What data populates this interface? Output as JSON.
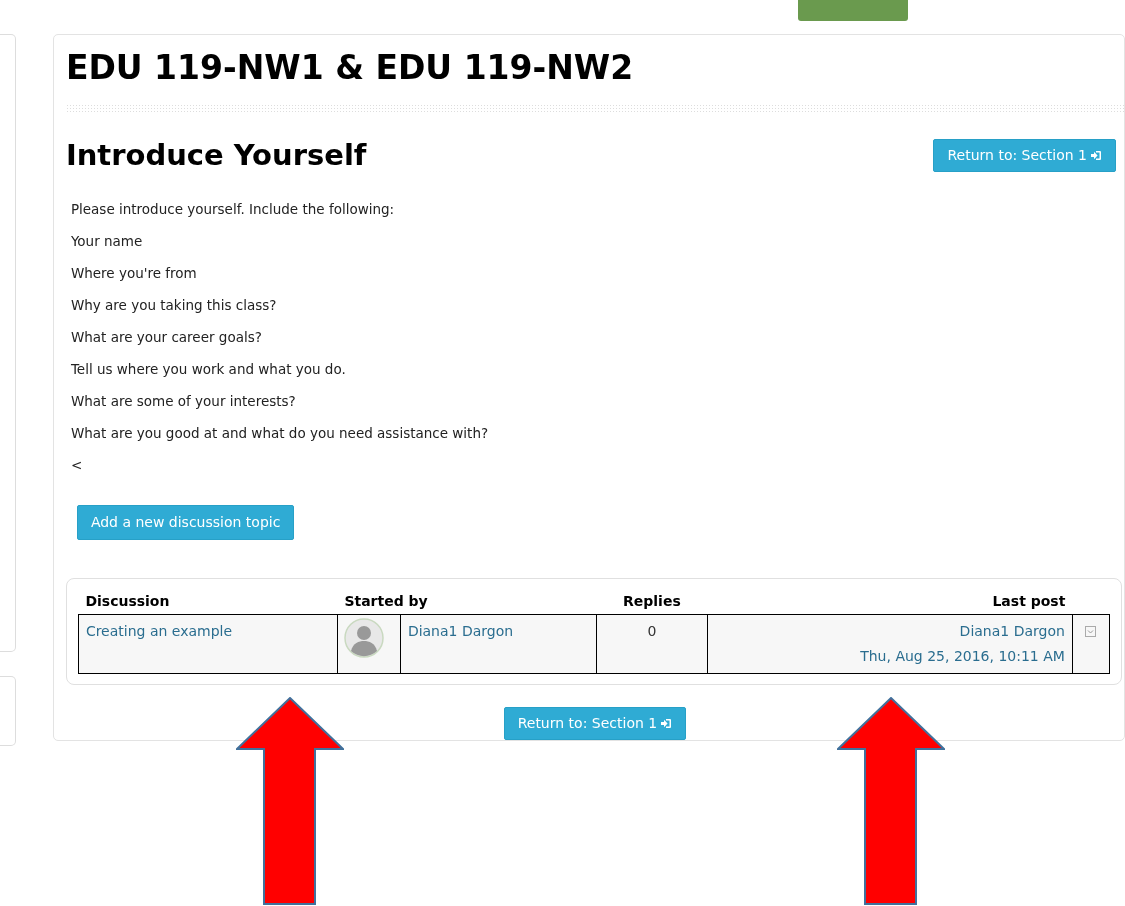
{
  "course_title": "EDU 119-NW1 & EDU 119-NW2",
  "forum": {
    "title": "Introduce Yourself",
    "return_button": "Return to: Section 1"
  },
  "intro": [
    "Please introduce yourself. Include the following:",
    "Your name",
    "Where you're from",
    "Why are you taking this class?",
    "What are your career goals?",
    "Tell us where you work and what you do.",
    "What are some of your interests?",
    "What are you good at and what do you need assistance with?",
    "<"
  ],
  "add_button": "Add a new discussion topic",
  "table": {
    "columns": [
      "Discussion",
      "Started by",
      "Replies",
      "Last post"
    ],
    "rows": [
      {
        "discussion": "Creating an example",
        "started_by": "Diana1 Dargon",
        "replies": "0",
        "last_post_author": "Diana1 Dargon",
        "last_post_date": "Thu, Aug 25, 2016, 10:11 AM"
      }
    ]
  },
  "bottom_return_button": "Return to: Section 1",
  "annotations": [
    {
      "kind": "arrow"
    },
    {
      "kind": "arrow"
    }
  ]
}
